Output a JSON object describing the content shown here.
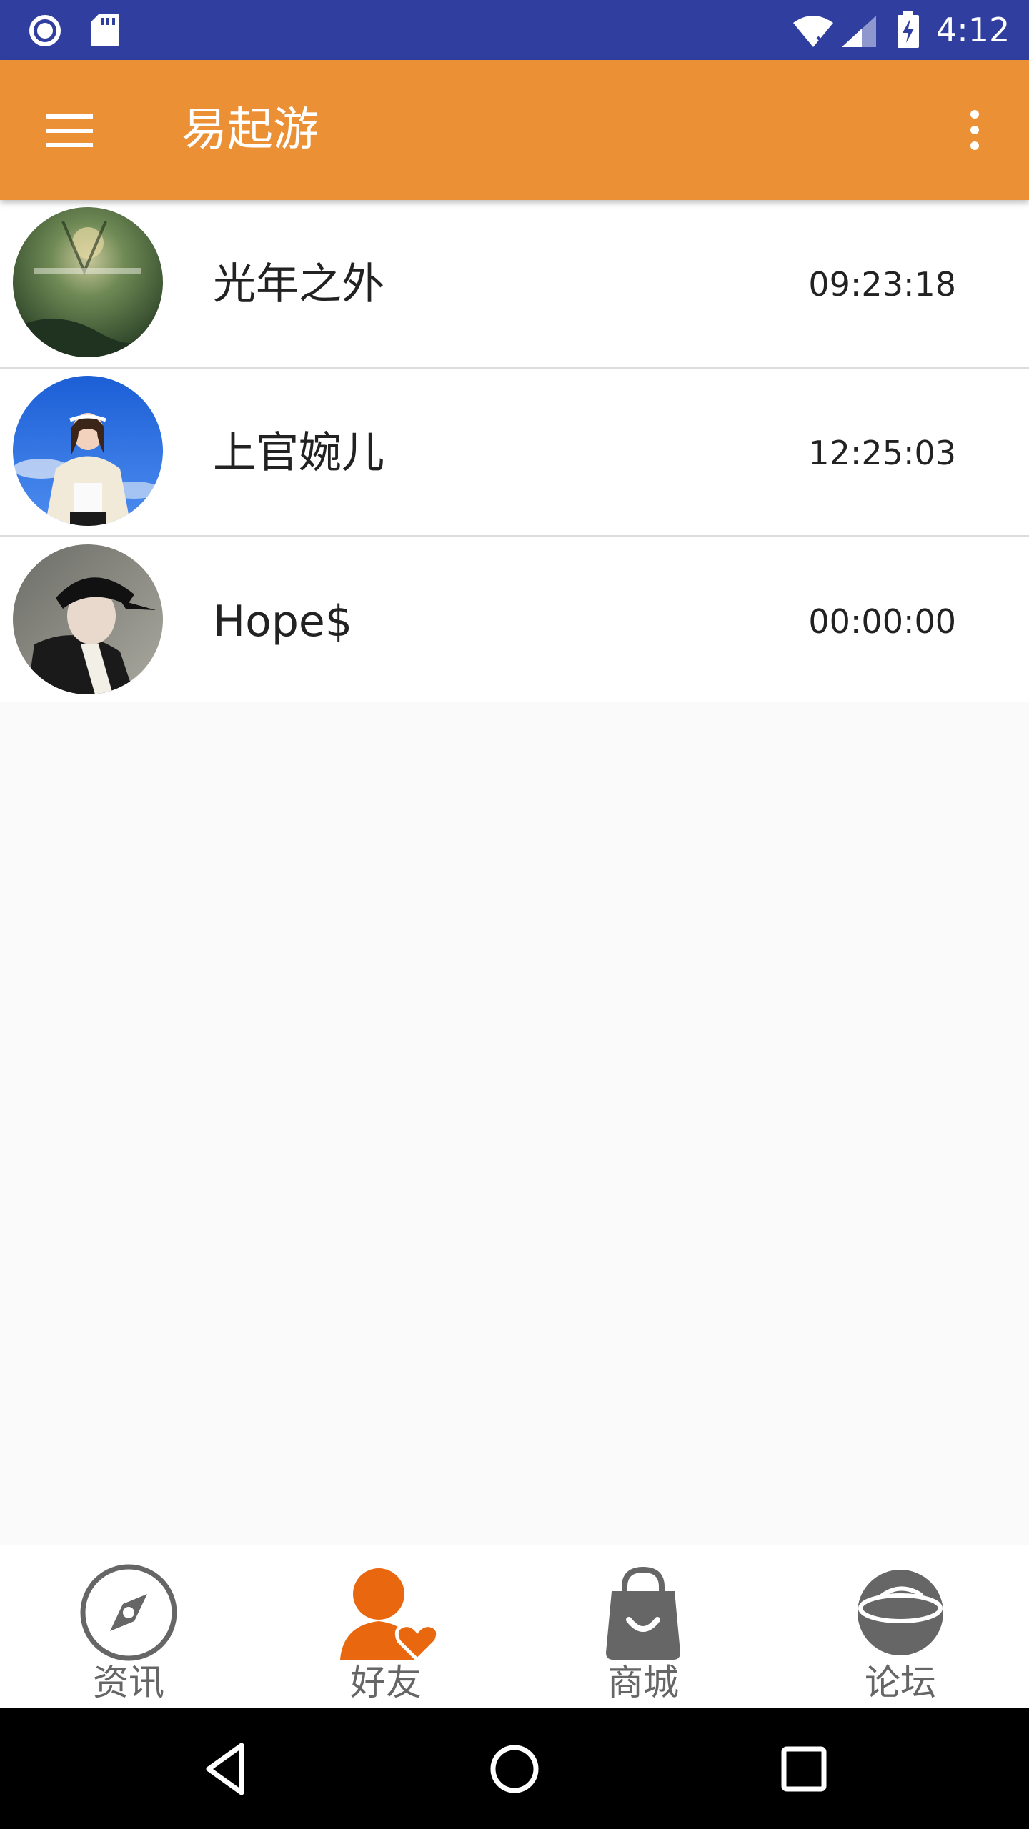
{
  "status_bar": {
    "time": "4:12",
    "icons": [
      "record-icon",
      "sd-card-icon",
      "wifi-icon",
      "signal-icon",
      "battery-charging-icon"
    ]
  },
  "app_bar": {
    "title": "易起游",
    "menu_icon": "hamburger-menu-icon",
    "overflow_icon": "more-vert-icon"
  },
  "friends": [
    {
      "name": "光年之外",
      "time": "09:23:18",
      "avatar": "avatar-forest"
    },
    {
      "name": "上官婉儿",
      "time": "12:25:03",
      "avatar": "avatar-girl-sky"
    },
    {
      "name": "Hope$",
      "time": "00:00:00",
      "avatar": "avatar-man-cap"
    }
  ],
  "bottom_nav": {
    "items": [
      {
        "label": "资讯",
        "icon": "compass-icon",
        "active": false
      },
      {
        "label": "好友",
        "icon": "friend-heart-icon",
        "active": true
      },
      {
        "label": "商城",
        "icon": "shopping-bag-icon",
        "active": false
      },
      {
        "label": "论坛",
        "icon": "planet-icon",
        "active": false
      }
    ]
  },
  "colors": {
    "status_bar": "#303f9f",
    "app_bar": "#eb9035",
    "active_nav": "#e8670f",
    "inactive_nav": "#666666"
  }
}
